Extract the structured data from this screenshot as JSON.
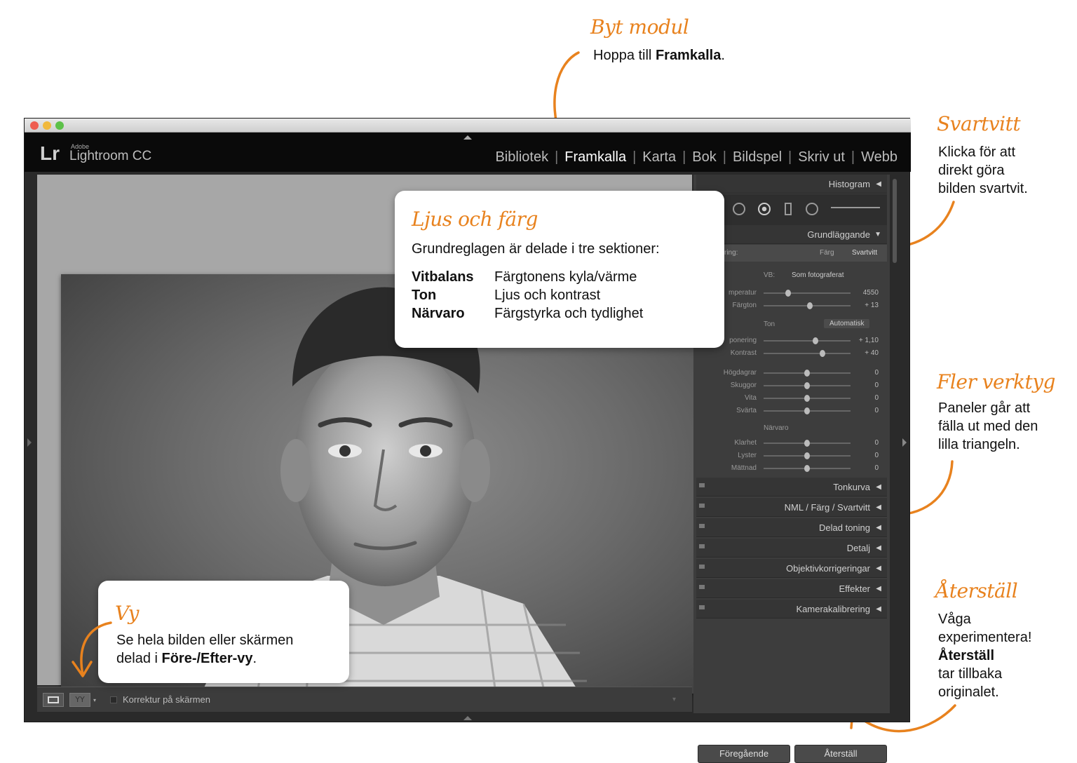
{
  "annotations": {
    "module": {
      "title": "Byt modul",
      "text_pre": "Hoppa till ",
      "text_bold": "Framkalla",
      "text_post": "."
    },
    "bw": {
      "title": "Svartvitt",
      "lines": [
        "Klicka för att",
        "direkt göra",
        "bilden svartvit."
      ]
    },
    "tools": {
      "title": "Fler verktyg",
      "lines": [
        "Paneler går att",
        "fälla ut med den",
        "lilla triangeln."
      ]
    },
    "reset": {
      "title": "Återställ",
      "line1": "Våga",
      "line2": "experimentera!",
      "bold": "Återställ",
      "line4": "tar tillbaka",
      "line5": "originalet."
    },
    "light": {
      "title": "Ljus och färg",
      "intro": "Grundreglagen är delade i tre sektioner:",
      "rows": [
        {
          "term": "Vitbalans",
          "desc": "Färgtonens kyla/värme"
        },
        {
          "term": "Ton",
          "desc": "Ljus och kontrast"
        },
        {
          "term": "Närvaro",
          "desc": "Färgstyrka och tydlighet"
        }
      ]
    },
    "view": {
      "title": "Vy",
      "line1": "Se hela bilden eller skärmen",
      "line2_pre": "delad i ",
      "line2_bold": "Före-/Efter-vy",
      "line2_post": "."
    }
  },
  "app": {
    "logo": "Lr",
    "adobe": "Adobe",
    "name": "Lightroom CC",
    "modules": [
      "Bibliotek",
      "Framkalla",
      "Karta",
      "Bok",
      "Bildspel",
      "Skriv ut",
      "Webb"
    ],
    "active_module": "Framkalla"
  },
  "panel": {
    "histogram": "Histogram",
    "basic": "Grundläggande",
    "treatment_label": "ring:",
    "treatment_color": "Färg",
    "treatment_bw": "Svartvitt",
    "wb_label": "VB:",
    "wb_value": "Som fotograferat",
    "sliders_wb": [
      {
        "label": "mperatur",
        "value": "4550",
        "pos": 0.28
      },
      {
        "label": "Färgton",
        "value": "+ 13",
        "pos": 0.53
      }
    ],
    "tone_label": "Ton",
    "auto_label": "Automatisk",
    "sliders_tone": [
      {
        "label": "ponering",
        "value": "+ 1,10",
        "pos": 0.6
      },
      {
        "label": "Kontrast",
        "value": "+ 40",
        "pos": 0.68
      }
    ],
    "sliders_tone2": [
      {
        "label": "Högdagrar",
        "value": "0",
        "pos": 0.5
      },
      {
        "label": "Skuggor",
        "value": "0",
        "pos": 0.5
      },
      {
        "label": "Vita",
        "value": "0",
        "pos": 0.5
      },
      {
        "label": "Svärta",
        "value": "0",
        "pos": 0.5
      }
    ],
    "presence_label": "Närvaro",
    "sliders_presence": [
      {
        "label": "Klarhet",
        "value": "0",
        "pos": 0.5
      },
      {
        "label": "Lyster",
        "value": "0",
        "pos": 0.5
      },
      {
        "label": "Mättnad",
        "value": "0",
        "pos": 0.5
      }
    ],
    "collapsed": [
      "Tonkurva",
      "NML / Färg / Svartvitt",
      "Delad toning",
      "Detalj",
      "Objektivkorrigeringar",
      "Effekter",
      "Kamerakalibrering"
    ],
    "btn_prev": "Föregående",
    "btn_reset": "Återställ"
  },
  "toolbar": {
    "proof_label": "Korrektur på skärmen"
  },
  "colors": {
    "accent": "#e8821e"
  }
}
